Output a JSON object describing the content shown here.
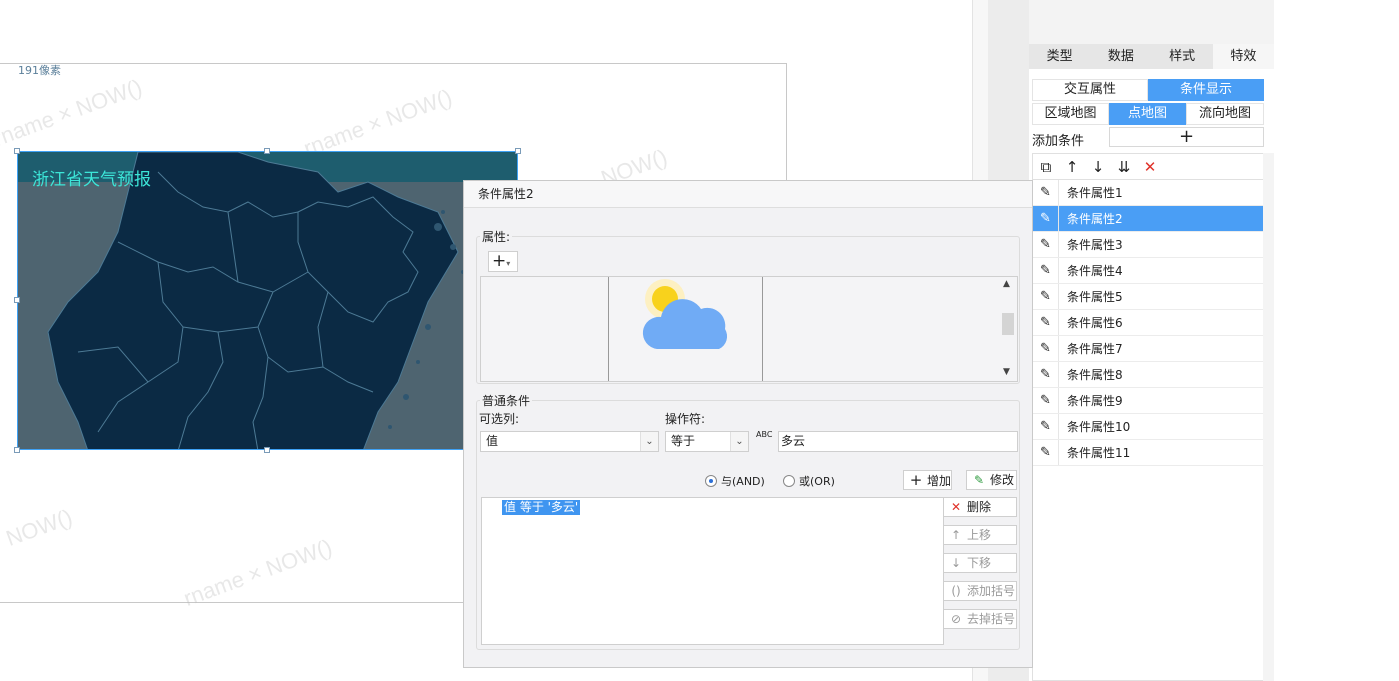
{
  "canvas": {
    "px_label": "191像素",
    "watermark": "NOW()",
    "watermark_user": "rname × NOW()",
    "map_title": "浙江省天气预报"
  },
  "panel": {
    "tabs": [
      {
        "label": "类型"
      },
      {
        "label": "数据"
      },
      {
        "label": "样式"
      },
      {
        "label": "特效"
      }
    ],
    "modes": [
      {
        "label": "交互属性"
      },
      {
        "label": "条件显示"
      }
    ],
    "map_types": [
      {
        "label": "区域地图"
      },
      {
        "label": "点地图"
      },
      {
        "label": "流向地图"
      }
    ],
    "add_condition_label": "添加条件",
    "add_condition_plus": "+",
    "toolbar_icons": [
      "copy-icon",
      "arrow-up-icon",
      "arrow-down-icon",
      "sort-bottom-icon",
      "delete-icon"
    ],
    "items": [
      {
        "label": "条件属性1"
      },
      {
        "label": "条件属性2"
      },
      {
        "label": "条件属性3"
      },
      {
        "label": "条件属性4"
      },
      {
        "label": "条件属性5"
      },
      {
        "label": "条件属性6"
      },
      {
        "label": "条件属性7"
      },
      {
        "label": "条件属性8"
      },
      {
        "label": "条件属性9"
      },
      {
        "label": "条件属性10"
      },
      {
        "label": "条件属性11"
      }
    ]
  },
  "dialog": {
    "title": "条件属性2",
    "attributes_label": "属性:",
    "general_label": "普通条件",
    "column_label": "可选列:",
    "operator_label": "操作符:",
    "column_value": "值",
    "operator_value": "等于",
    "abc_icon_text": "ABC",
    "condition_value": "多云",
    "and_label": "与(AND)",
    "or_label": "或(OR)",
    "add_btn": "增加",
    "modify_btn": "修改",
    "expression": "值 等于 '多云'",
    "delete_btn": "删除",
    "up_btn": "上移",
    "down_btn": "下移",
    "add_bracket_btn": "添加括号",
    "remove_bracket_btn": "去掉括号"
  },
  "colors": {
    "accent": "#4a9ef5",
    "map_bg": "#4e6470",
    "map_region": "#0b2a44",
    "map_title": "#3ce6d8"
  }
}
